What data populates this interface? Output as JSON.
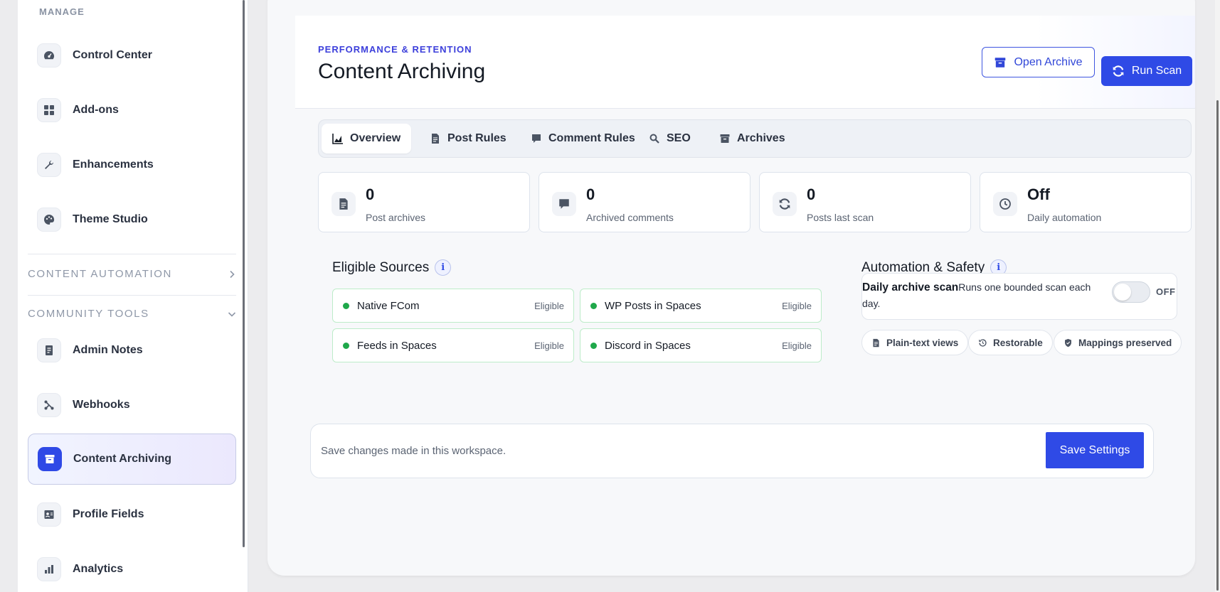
{
  "sidebar": {
    "manage_title": "MANAGE",
    "items_top": [
      {
        "label": "Control Center",
        "icon": "gauge-icon"
      },
      {
        "label": "Add-ons",
        "icon": "grid-icon"
      },
      {
        "label": "Enhancements",
        "icon": "wrench-icon"
      },
      {
        "label": "Theme Studio",
        "icon": "palette-icon"
      }
    ],
    "section_content_automation": "CONTENT AUTOMATION",
    "section_community_tools": "COMMUNITY TOOLS",
    "items_community": [
      {
        "label": "Admin Notes",
        "icon": "notes-icon"
      },
      {
        "label": "Webhooks",
        "icon": "webhook-icon"
      },
      {
        "label": "Content Archiving",
        "icon": "archive-icon",
        "active": true
      },
      {
        "label": "Profile Fields",
        "icon": "id-card-icon"
      },
      {
        "label": "Analytics",
        "icon": "bar-chart-icon"
      }
    ]
  },
  "header": {
    "eyebrow": "PERFORMANCE & RETENTION",
    "title": "Content Archiving",
    "open_archive_label": "Open Archive",
    "run_scan_label": "Run Scan"
  },
  "tabs": [
    {
      "label": "Overview",
      "icon": "chart-area-icon",
      "active": true
    },
    {
      "label": "Post Rules",
      "icon": "document-icon"
    },
    {
      "label": "Comment Rules",
      "icon": "comment-icon"
    },
    {
      "label": "SEO",
      "icon": "search-icon"
    },
    {
      "label": "Archives",
      "icon": "archive-icon"
    }
  ],
  "stats": [
    {
      "value": "0",
      "caption": "Post archives",
      "icon": "document-icon"
    },
    {
      "value": "0",
      "caption": "Archived comments",
      "icon": "comment-icon"
    },
    {
      "value": "0",
      "caption": "Posts last scan",
      "icon": "refresh-icon"
    },
    {
      "value": "Off",
      "caption": "Daily automation",
      "icon": "clock-icon"
    }
  ],
  "eligible": {
    "title": "Eligible Sources",
    "info": "i",
    "sources": [
      {
        "name": "Native FCom",
        "status": "Eligible"
      },
      {
        "name": "WP Posts in Spaces",
        "status": "Eligible"
      },
      {
        "name": "Feeds in Spaces",
        "status": "Eligible"
      },
      {
        "name": "Discord in Spaces",
        "status": "Eligible"
      }
    ]
  },
  "automation": {
    "title": "Automation & Safety",
    "info": "i",
    "daily_scan_title": "Daily archive scan",
    "daily_scan_desc": "Runs one bounded scan each day.",
    "toggle_state": "OFF",
    "chips": [
      {
        "label": "Plain-text views",
        "icon": "document-icon"
      },
      {
        "label": "Restorable",
        "icon": "history-icon"
      },
      {
        "label": "Mappings preserved",
        "icon": "shield-icon"
      }
    ]
  },
  "savebar": {
    "hint": "Save changes made in this workspace.",
    "save_label": "Save Settings"
  },
  "colors": {
    "accent": "#2f4ae6",
    "eyebrow": "#3c3fdb",
    "eligible_dot": "#1fa84a"
  }
}
